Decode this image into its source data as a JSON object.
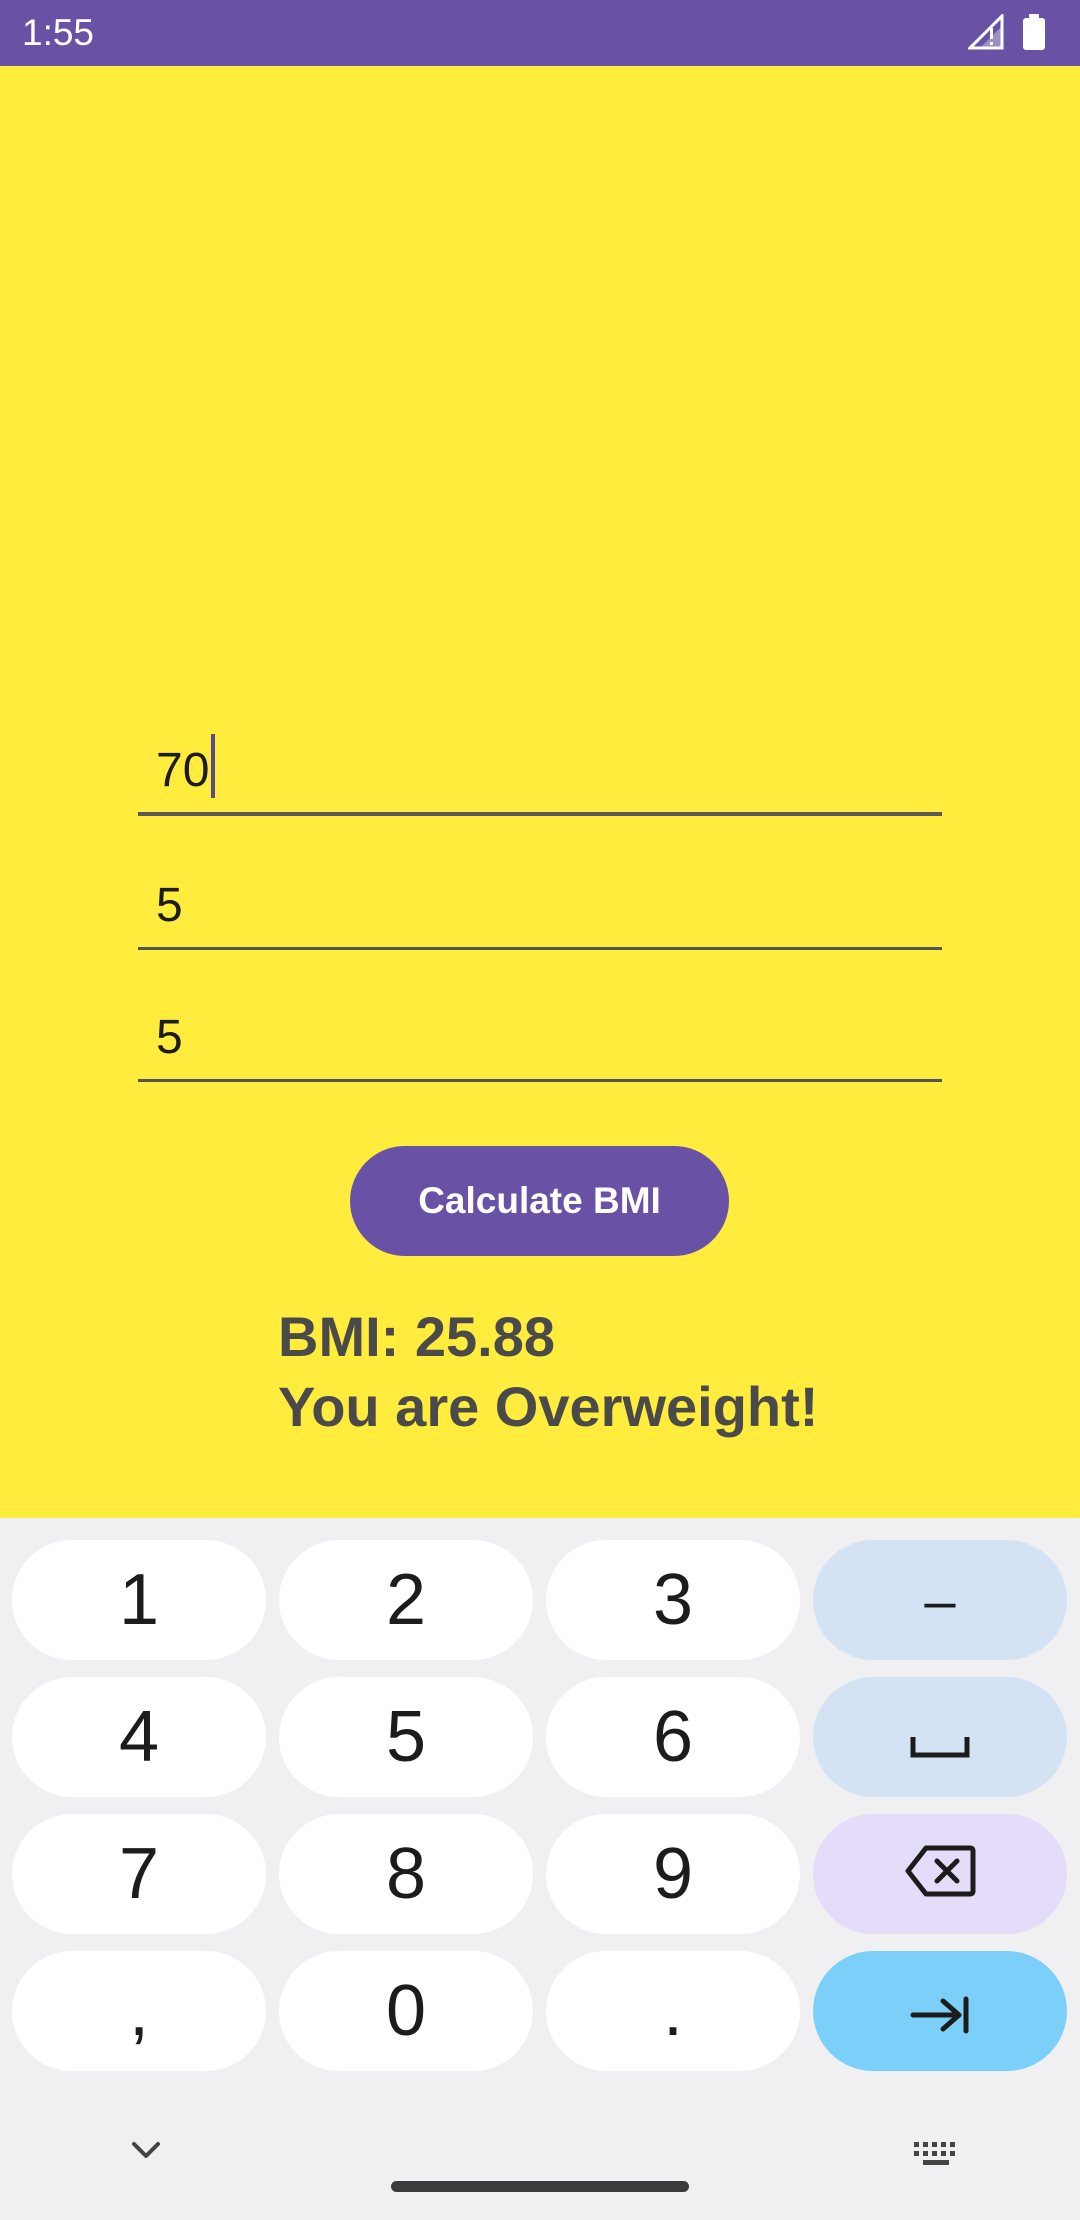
{
  "status_bar": {
    "time": "1:55",
    "background": "#6952a6",
    "icons": [
      "signal-icon",
      "battery-icon"
    ]
  },
  "app": {
    "background": "#ffec3d",
    "fields": [
      {
        "value": "70",
        "focused": true
      },
      {
        "value": "5",
        "focused": false
      },
      {
        "value": "5",
        "focused": false
      }
    ],
    "calculate_button": {
      "label": "Calculate BMI",
      "color": "#6952a6"
    },
    "result": {
      "bmi_line": "BMI: 25.88",
      "status_line": "You are Overweight!"
    }
  },
  "keyboard": {
    "rows": [
      [
        "1",
        "2",
        "3",
        "–"
      ],
      [
        "4",
        "5",
        "6",
        "space-icon"
      ],
      [
        "7",
        "8",
        "9",
        "backspace-icon"
      ],
      [
        ",",
        "0",
        ".",
        "tab-next-icon"
      ]
    ],
    "keys": {
      "k1": "1",
      "k2": "2",
      "k3": "3",
      "dash": "–",
      "k4": "4",
      "k5": "5",
      "k6": "6",
      "k7": "7",
      "k8": "8",
      "k9": "9",
      "comma": ",",
      "k0": "0",
      "period": "."
    },
    "accent_colors": {
      "function_key": "#d3e3f3",
      "delete_key": "#e4dcf8",
      "enter_key": "#7ccff8"
    }
  },
  "navigation": {
    "icons": [
      "chevron-down-icon",
      "keyboard-icon",
      "home-bar"
    ]
  }
}
